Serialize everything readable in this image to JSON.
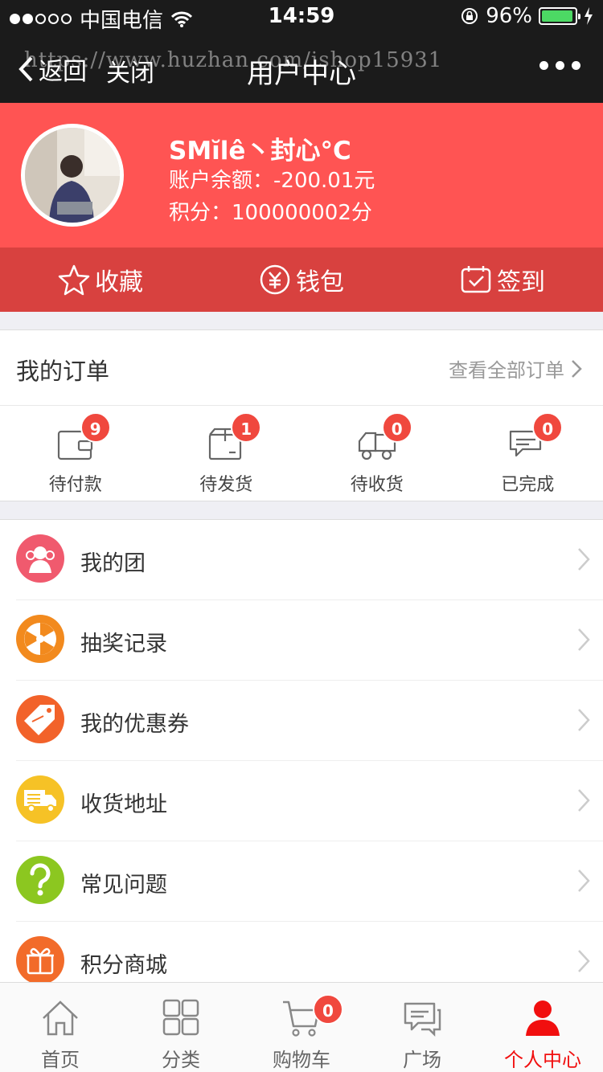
{
  "status": {
    "carrier": "中国电信",
    "time": "14:59",
    "battery": "96%",
    "battery_level": 0.96
  },
  "nav": {
    "back_label": "返回",
    "close_label": "关闭",
    "title": "用户中心",
    "watermark": "https://www.huzhan.com/ishop15931"
  },
  "profile": {
    "name": "SMĭlê丶封心°C",
    "balance_label": "账户余额：",
    "balance_value": "-200.01元",
    "points_label": "积分：",
    "points_value": "100000002分"
  },
  "quick": [
    {
      "label": "收藏",
      "icon": "star-icon"
    },
    {
      "label": "钱包",
      "icon": "yuan-wallet-icon"
    },
    {
      "label": "签到",
      "icon": "calendar-check-icon"
    }
  ],
  "orders": {
    "title": "我的订单",
    "view_all": "查看全部订单",
    "items": [
      {
        "label": "待付款",
        "count": "9",
        "icon": "wallet-icon"
      },
      {
        "label": "待发货",
        "count": "1",
        "icon": "package-icon"
      },
      {
        "label": "待收货",
        "count": "0",
        "icon": "truck-icon"
      },
      {
        "label": "已完成",
        "count": "0",
        "icon": "chat-bubble-icon"
      }
    ]
  },
  "menu": [
    {
      "label": "我的团",
      "icon": "group-icon",
      "color": "#f05a6e"
    },
    {
      "label": "抽奖记录",
      "icon": "lottery-wheel-icon",
      "color": "#f28a1e"
    },
    {
      "label": "我的优惠券",
      "icon": "sale-tag-icon",
      "color": "#f2622a"
    },
    {
      "label": "收货地址",
      "icon": "delivery-truck-icon",
      "color": "#f6c226"
    },
    {
      "label": "常见问题",
      "icon": "question-icon",
      "color": "#8cc720"
    },
    {
      "label": "积分商城",
      "icon": "gift-icon",
      "color": "#f26b2a"
    }
  ],
  "tabs": [
    {
      "label": "首页",
      "icon": "home-icon"
    },
    {
      "label": "分类",
      "icon": "grid-icon"
    },
    {
      "label": "购物车",
      "icon": "cart-icon",
      "count": "0"
    },
    {
      "label": "广场",
      "icon": "chat-icon"
    },
    {
      "label": "个人中心",
      "icon": "person-icon",
      "active": true
    }
  ],
  "colors": {
    "brand_red": "#ff5453",
    "quickbar_red": "#d8413f",
    "badge_red": "#f0483e",
    "active_tab": "#f10f0f"
  }
}
